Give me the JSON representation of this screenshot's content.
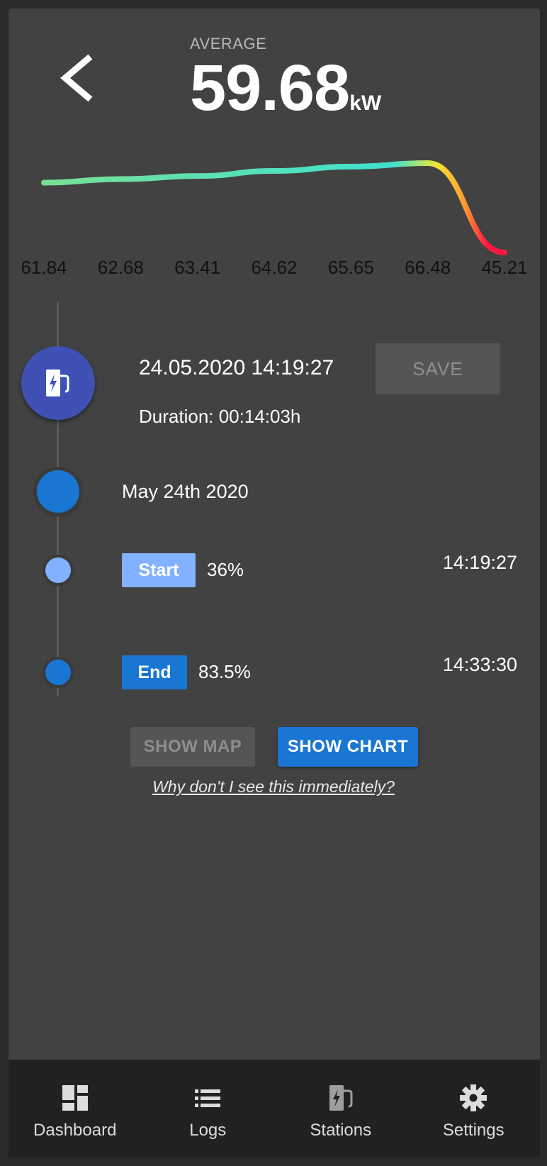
{
  "header": {
    "average_label": "AVERAGE",
    "average_value": "59.68",
    "average_unit": "kW"
  },
  "chart_data": {
    "type": "line",
    "categories": [
      "61.84",
      "62.68",
      "63.41",
      "64.62",
      "65.65",
      "66.48",
      "45.21"
    ],
    "values": [
      61.84,
      62.68,
      63.41,
      64.62,
      65.65,
      66.48,
      45.21
    ],
    "gradient_colors": [
      "#7ee08e",
      "#3fe0d0",
      "#f5e632",
      "#ff9a2e",
      "#ff1744"
    ]
  },
  "session": {
    "datetime": "24.05.2020 14:19:27",
    "duration": "Duration: 00:14:03h",
    "save_label": "SAVE"
  },
  "timeline": {
    "day": "May 24th 2020",
    "start": {
      "label": "Start",
      "percent": "36%",
      "time": "14:19:27"
    },
    "end": {
      "label": "End",
      "percent": "83.5%",
      "time": "14:33:30"
    }
  },
  "actions": {
    "show_map": "SHOW MAP",
    "show_chart": "SHOW CHART",
    "why_link": "Why don't I see this immediately?"
  },
  "nav": {
    "items": [
      {
        "label": "Dashboard",
        "icon": "dashboard-icon"
      },
      {
        "label": "Logs",
        "icon": "list-icon"
      },
      {
        "label": "Stations",
        "icon": "ev-station-icon"
      },
      {
        "label": "Settings",
        "icon": "gear-icon"
      }
    ]
  },
  "colors": {
    "background": "#424242",
    "primary": "#1976d2",
    "start_chip": "#82b1ff",
    "indigo": "#3f51b5"
  }
}
